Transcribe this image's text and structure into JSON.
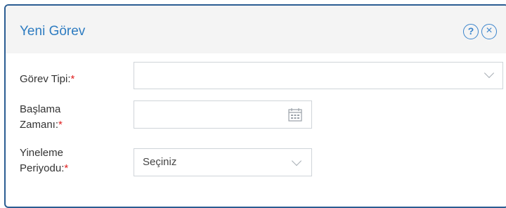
{
  "dialog": {
    "title": "Yeni Görev",
    "help_icon": "help-icon",
    "close_icon": "close-icon"
  },
  "form": {
    "task_type": {
      "label": "Görev Tipi:",
      "required_mark": "*",
      "value": ""
    },
    "start_time": {
      "label_line1": "Başlama",
      "label_line2": "Zamanı:",
      "required_mark": "*",
      "value": "",
      "icon": "calendar-icon"
    },
    "repeat_period": {
      "label_line1": "Yineleme",
      "label_line2": "Periyodu:",
      "required_mark": "*",
      "value": "Seçiniz"
    }
  },
  "colors": {
    "border": "#2b5d92",
    "title": "#2e7cc1",
    "required": "#e02020",
    "header_bg": "#f4f4f4"
  }
}
